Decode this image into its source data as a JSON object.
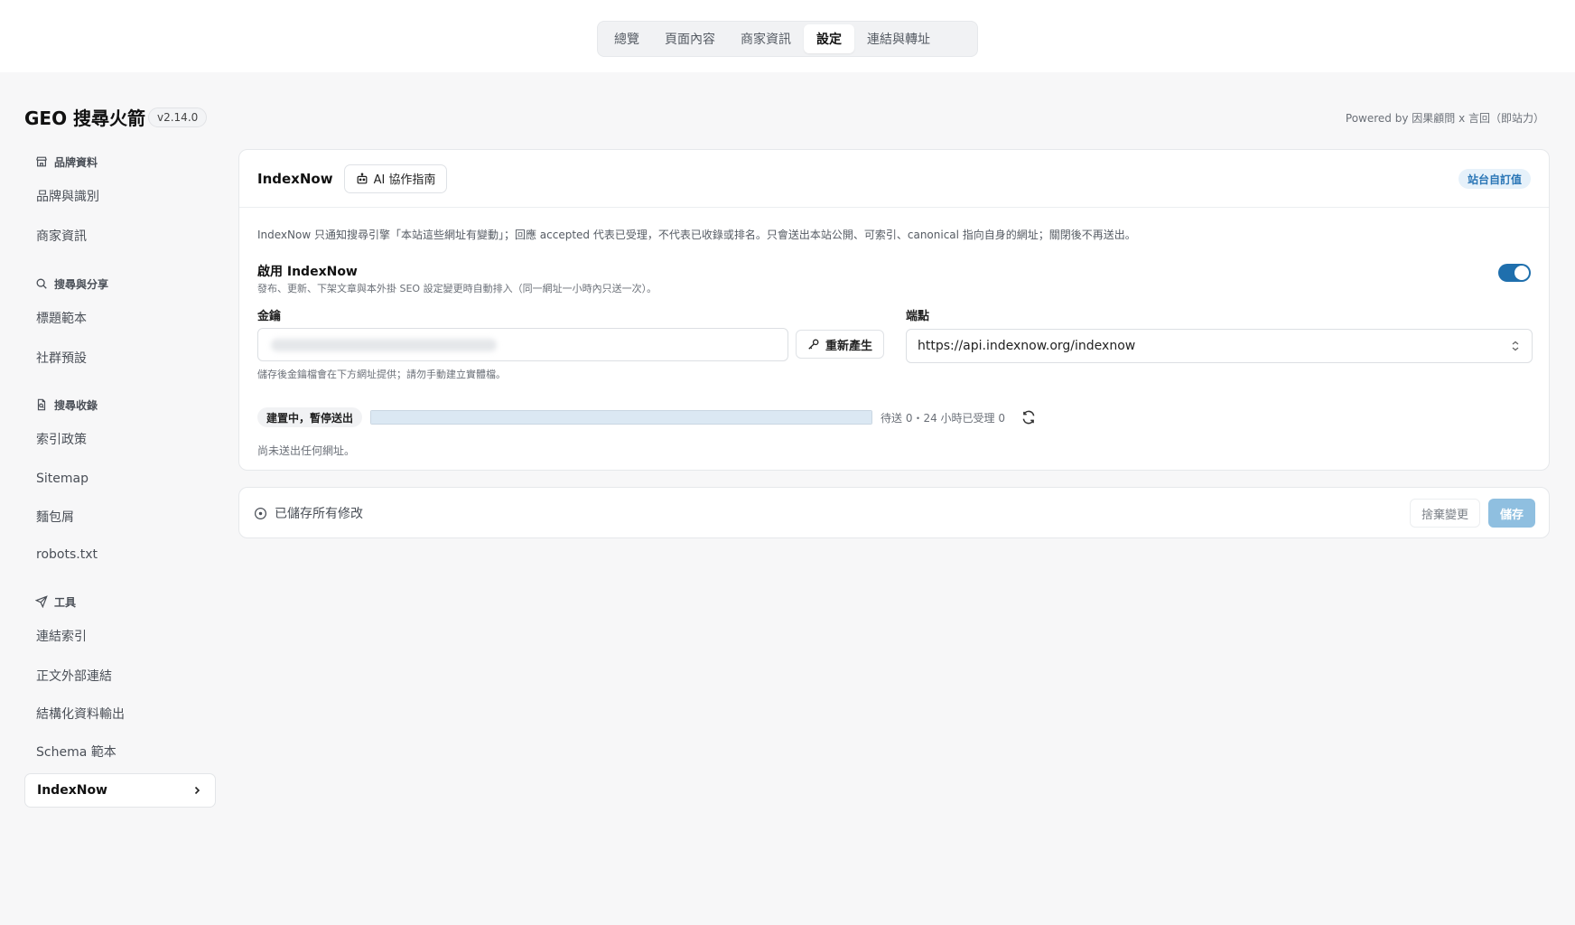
{
  "nav": {
    "tabs": [
      {
        "label": "總覽"
      },
      {
        "label": "頁面內容"
      },
      {
        "label": "商家資訊"
      },
      {
        "label": "設定"
      },
      {
        "label": "連結與轉址"
      }
    ],
    "active_tab": "設定"
  },
  "app": {
    "title": "GEO 搜尋火箭",
    "version": "v2.14.0",
    "powered_by": "Powered by 因果顧問 x 言回（即站力）"
  },
  "sidebar": {
    "sections": [
      {
        "label": "品牌資料",
        "icon": "storefront-icon",
        "items": [
          {
            "label": "品牌與識別"
          },
          {
            "label": "商家資訊"
          }
        ]
      },
      {
        "label": "搜尋與分享",
        "icon": "search-icon",
        "items": [
          {
            "label": "標題範本"
          },
          {
            "label": "社群預設"
          }
        ]
      },
      {
        "label": "搜尋收錄",
        "icon": "file-search-icon",
        "items": [
          {
            "label": "索引政策"
          },
          {
            "label": "Sitemap"
          },
          {
            "label": "麵包屑"
          },
          {
            "label": "robots.txt"
          }
        ]
      },
      {
        "label": "工具",
        "icon": "send-icon",
        "items": [
          {
            "label": "連結索引"
          },
          {
            "label": "正文外部連結"
          },
          {
            "label": "結構化資料輸出"
          },
          {
            "label": "Schema 範本"
          },
          {
            "label": "IndexNow"
          }
        ]
      }
    ],
    "active_item": "IndexNow"
  },
  "card": {
    "title": "IndexNow",
    "guide_button": "AI 協作指南",
    "badge": "站台自訂值",
    "intro": "IndexNow 只通知搜尋引擎「本站這些網址有變動」；回應 accepted 代表已受理，不代表已收錄或排名。只會送出本站公開、可索引、canonical 指向自身的網址；關閉後不再送出。",
    "enable_label": "啟用 IndexNow",
    "enable_desc": "發布、更新、下架文章與本外掛 SEO 設定變更時自動排入（同一網址一小時內只送一次）。",
    "enabled": true,
    "key_label": "金鑰",
    "regenerate_button": "重新產生",
    "key_hint": "儲存後金鑰檔會在下方網址提供；請勿手動建立實體檔。",
    "endpoint_label": "端點",
    "endpoint_value": "https://api.indexnow.org/indexnow",
    "status_pill": "建置中，暫停送出",
    "queue_text": "待送 0・24 小時已受理 0",
    "progress": 1.0,
    "no_sent": "尚未送出任何網址。"
  },
  "savebar": {
    "status": "已儲存所有修改",
    "discard_button": "捨棄變更",
    "save_button": "儲存"
  }
}
